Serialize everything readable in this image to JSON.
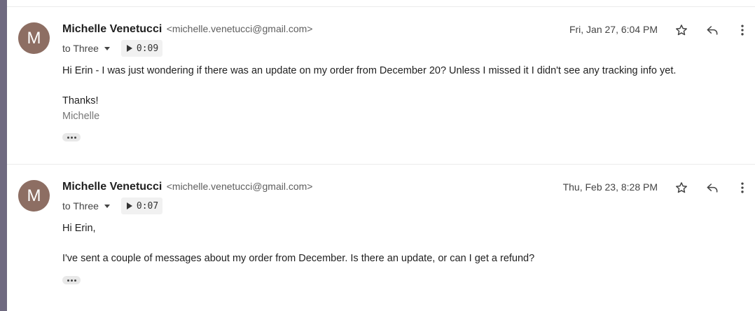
{
  "messages": [
    {
      "avatar_letter": "M",
      "sender_name": "Michelle Venetucci",
      "sender_email": "<michelle.venetucci@gmail.com>",
      "recipients": "to Three",
      "audio_duration": "0:09",
      "date": "Fri, Jan 27, 6:04 PM",
      "body": [
        "Hi Erin - I was just wondering if there was an update on my order from December 20? Unless I missed it I didn't see any tracking info yet.",
        "Thanks!"
      ],
      "signature": "Michelle"
    },
    {
      "avatar_letter": "M",
      "sender_name": "Michelle Venetucci",
      "sender_email": "<michelle.venetucci@gmail.com>",
      "recipients": "to Three",
      "audio_duration": "0:07",
      "date": "Thu, Feb 23, 8:28 PM",
      "body": [
        "Hi Erin,",
        "I've sent a couple of messages about my order from December. Is there an update, or can I get a refund?"
      ]
    }
  ],
  "icons": {
    "star": "star-icon",
    "reply": "reply-icon",
    "more": "more-vert-icon",
    "caret": "caret-down-icon",
    "play": "play-icon",
    "ellipsis": "show-trimmed-content-icon"
  },
  "colors": {
    "avatar_bg": "#8d6e63",
    "left_strip": "#6f6a80"
  }
}
